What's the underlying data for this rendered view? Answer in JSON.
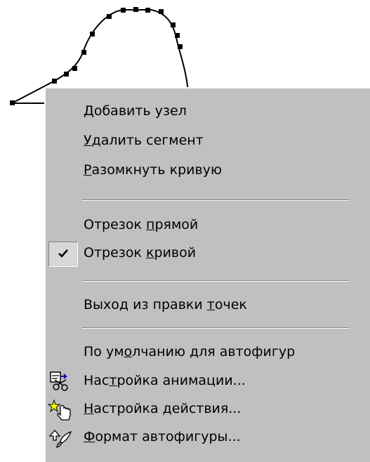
{
  "curve": {
    "nodes": 14
  },
  "menu": {
    "items": [
      {
        "pre": "",
        "hot": "Д",
        "post": "обавить узел"
      },
      {
        "pre": "",
        "hot": "У",
        "post": "далить сегмент"
      },
      {
        "pre": "",
        "hot": "Р",
        "post": "азомкнуть кривую"
      },
      {
        "pre": "Отрезок ",
        "hot": "п",
        "post": "рямой"
      },
      {
        "pre": "Отрезок ",
        "hot": "к",
        "post": "ривой",
        "checked": true
      },
      {
        "pre": "Выход из правки ",
        "hot": "т",
        "post": "очек"
      },
      {
        "pre": "По ум",
        "hot": "о",
        "post": "лчанию для автофигур"
      },
      {
        "pre": "Нас",
        "hot": "т",
        "post": "ройка анимации...",
        "icon": "animation-settings-icon"
      },
      {
        "pre": "",
        "hot": "Н",
        "post": "астройка действия...",
        "icon": "action-settings-icon"
      },
      {
        "pre": "",
        "hot": "Ф",
        "post": "ормат автофигуры...",
        "icon": "format-autoshape-icon"
      }
    ]
  },
  "colors": {
    "menu_bg": "#c0c0c0",
    "highlight": "#ffffff",
    "shadow": "#808080",
    "text": "#000000"
  }
}
